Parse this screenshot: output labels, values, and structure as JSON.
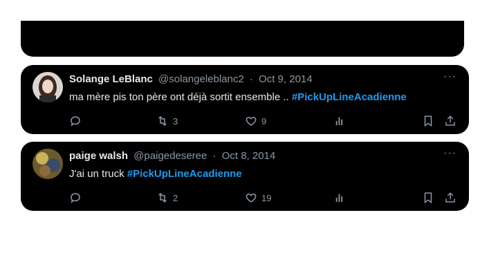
{
  "tweets": [
    {
      "display_name": "Solange LeBlanc",
      "handle": "@solangeleblanc2",
      "separator": "·",
      "date": "Oct 9, 2014",
      "text": "ma mère pis ton père ont déjà sortit ensemble .. ",
      "hashtag": "#PickUpLineAcadienne",
      "retweet_count": "3",
      "like_count": "9",
      "more_label": "···"
    },
    {
      "display_name": "paige walsh",
      "handle": "@paigedeseree",
      "separator": "·",
      "date": "Oct 8, 2014",
      "text": "J'ai un truck ",
      "hashtag": "#PickUpLineAcadienne",
      "retweet_count": "2",
      "like_count": "19",
      "more_label": "···"
    }
  ],
  "colors": {
    "card_bg": "#000000",
    "text": "#e7e9ea",
    "muted": "#8b98a5",
    "hashtag": "#1d9bf0"
  },
  "icons": [
    "reply-icon",
    "retweet-icon",
    "like-icon",
    "views-icon",
    "bookmark-icon",
    "share-icon",
    "more-icon"
  ]
}
